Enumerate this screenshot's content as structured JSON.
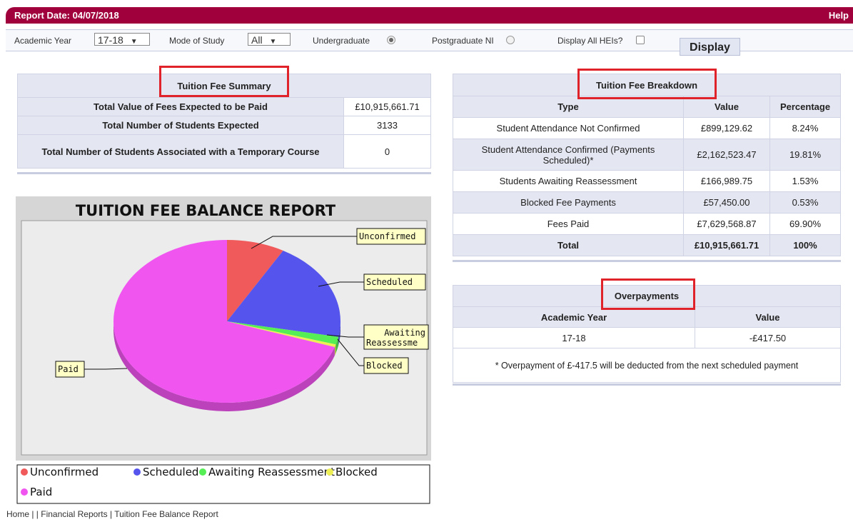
{
  "header": {
    "report_date": "Report Date: 04/07/2018",
    "help": "Help"
  },
  "filters": {
    "academic_year_label": "Academic Year",
    "academic_year_value": "17-18",
    "mode_label": "Mode of Study",
    "mode_value": "All",
    "undergraduate_label": "Undergraduate",
    "undergraduate_selected": true,
    "postgraduate_label": "Postgraduate NI",
    "postgraduate_selected": false,
    "display_all_label": "Display All HEIs?",
    "display_all_checked": false,
    "display_button": "Display",
    "dropdown_arrow": "▼"
  },
  "summary": {
    "title": "Tuition Fee Summary",
    "rows": [
      {
        "label": "Total Value of Fees Expected to be Paid",
        "value": "£10,915,661.71"
      },
      {
        "label": "Total Number of Students Expected",
        "value": "3133"
      },
      {
        "label": "Total Number of Students Associated with a Temporary Course",
        "value": "0"
      }
    ]
  },
  "breakdown": {
    "title": "Tuition Fee Breakdown",
    "headers": [
      "Type",
      "Value",
      "Percentage"
    ],
    "rows": [
      {
        "type": "Student Attendance Not Confirmed",
        "value": "£899,129.62",
        "percent": "8.24%"
      },
      {
        "type": "Student Attendance Confirmed (Payments Scheduled)*",
        "value": "£2,162,523.47",
        "percent": "19.81%"
      },
      {
        "type": "Students Awaiting Reassessment",
        "value": "£166,989.75",
        "percent": "1.53%"
      },
      {
        "type": "Blocked Fee Payments",
        "value": "£57,450.00",
        "percent": "0.53%"
      },
      {
        "type": "Fees Paid",
        "value": "£7,629,568.87",
        "percent": "69.90%"
      }
    ],
    "total": {
      "label": "Total",
      "value": "£10,915,661.71",
      "percent": "100%"
    }
  },
  "overpayments": {
    "title": "Overpayments",
    "headers": [
      "Academic Year",
      "Value"
    ],
    "rows": [
      {
        "year": "17-18",
        "value": "-£417.50"
      }
    ],
    "note": "* Overpayment of £-417.5 will be deducted from the next scheduled payment"
  },
  "chart_data": {
    "type": "pie",
    "title": "TUITION FEE BALANCE REPORT",
    "slices": [
      {
        "label": "Unconfirmed",
        "value": 8.24,
        "color": "#f05a5a"
      },
      {
        "label": "Scheduled",
        "value": 19.81,
        "color": "#5555ee"
      },
      {
        "label": "Awaiting Reassessment",
        "value": 1.53,
        "color": "#55ee55"
      },
      {
        "label": "Blocked",
        "value": 0.53,
        "color": "#eeee55"
      },
      {
        "label": "Paid",
        "value": 69.9,
        "color": "#f055f0"
      }
    ],
    "callouts": [
      "Unconfirmed",
      "Scheduled",
      "Awaiting Reassessme",
      "Blocked",
      "Paid"
    ],
    "legend": [
      "Unconfirmed",
      "Scheduled",
      "Awaiting Reassessment",
      "Blocked",
      "Paid"
    ],
    "legend_placement": "bottom"
  },
  "breadcrumb": "Home |   | Financial Reports | Tuition Fee Balance Report"
}
